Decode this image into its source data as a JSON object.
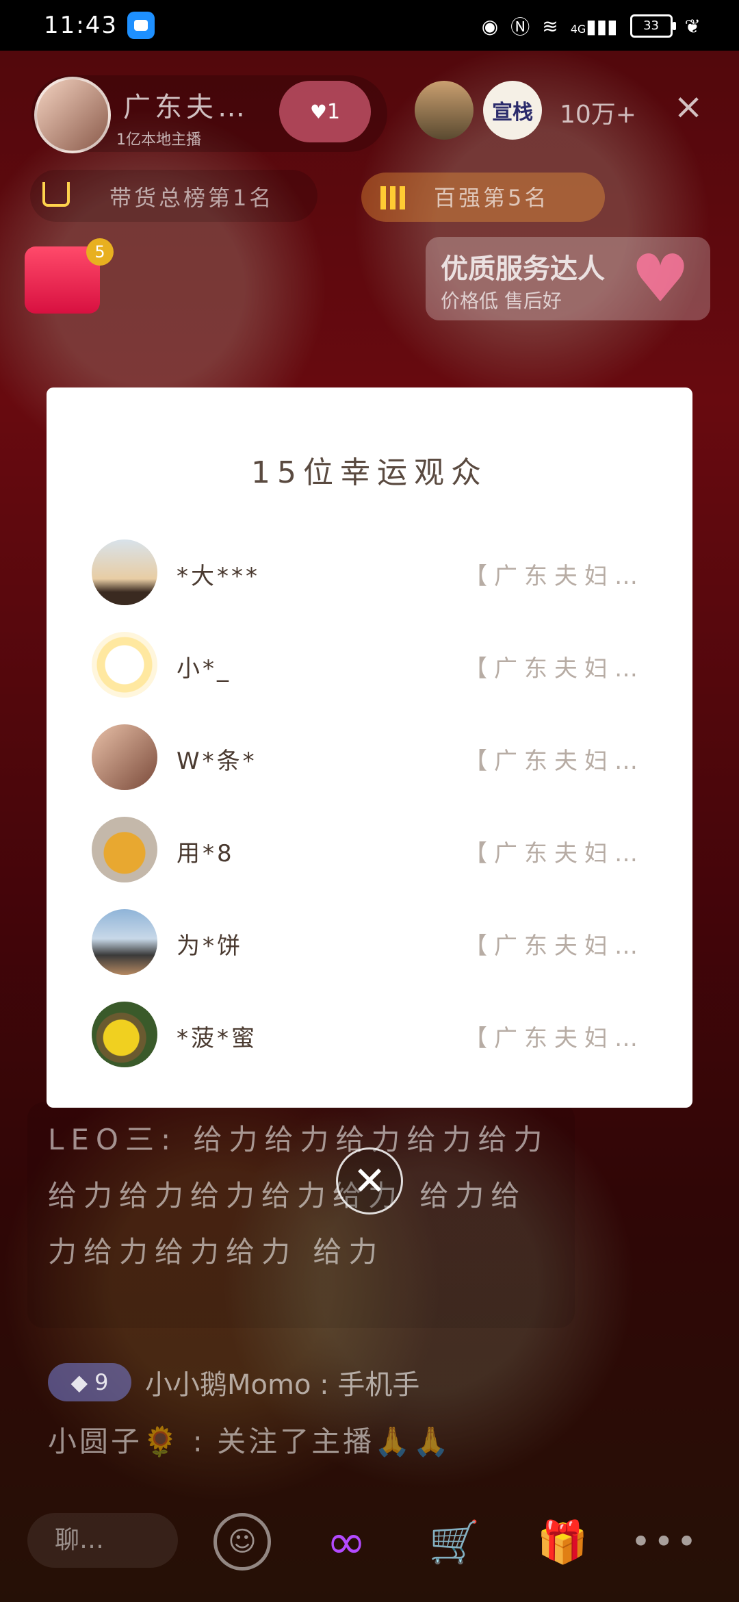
{
  "status_bar": {
    "time": "11:43",
    "network": "4G",
    "battery": "33"
  },
  "header": {
    "host_name": "广东夫…",
    "host_sub": "1亿本地主播",
    "follow_label": "1",
    "brand_label": "宣栈",
    "viewer_count": "10万+",
    "close_icon": "×"
  },
  "ranks": {
    "shop_rank": "带货总榜第1名",
    "hot_rank": "百强第5名"
  },
  "service_card": {
    "title": "优质服务达人",
    "subtitle": "价格低 售后好"
  },
  "red_packet": {
    "count": "5"
  },
  "modal": {
    "title": "15位幸运观众",
    "winners": [
      {
        "name": "*大***",
        "prize": "【广东夫妇…",
        "avatar_color": "#c9b9a0"
      },
      {
        "name": "小*_",
        "prize": "【广东夫妇…",
        "avatar_color": "#fff4d0"
      },
      {
        "name": "W*条*",
        "prize": "【广东夫妇…",
        "avatar_color": "#d9a58c"
      },
      {
        "name": "用*8",
        "prize": "【广东夫妇…",
        "avatar_color": "#b4a898"
      },
      {
        "name": "为*饼",
        "prize": "【广东夫妇…",
        "avatar_color": "#8fb4d8"
      },
      {
        "name": "*菠*蜜",
        "prize": "【广东夫妇…",
        "avatar_color": "#e2c24a"
      }
    ]
  },
  "chat": {
    "gift_text": "LEO三: 给力给力给力给力给力 给力给力给力给力给力 给力给力给力给力给力 给力",
    "user_level": "9",
    "user_msg": "小小鹅Momo : 手机手",
    "user_msg2": "小圆子🌻 : 关注了主播🙏🙏"
  },
  "bottom_bar": {
    "say_placeholder": "聊…"
  }
}
